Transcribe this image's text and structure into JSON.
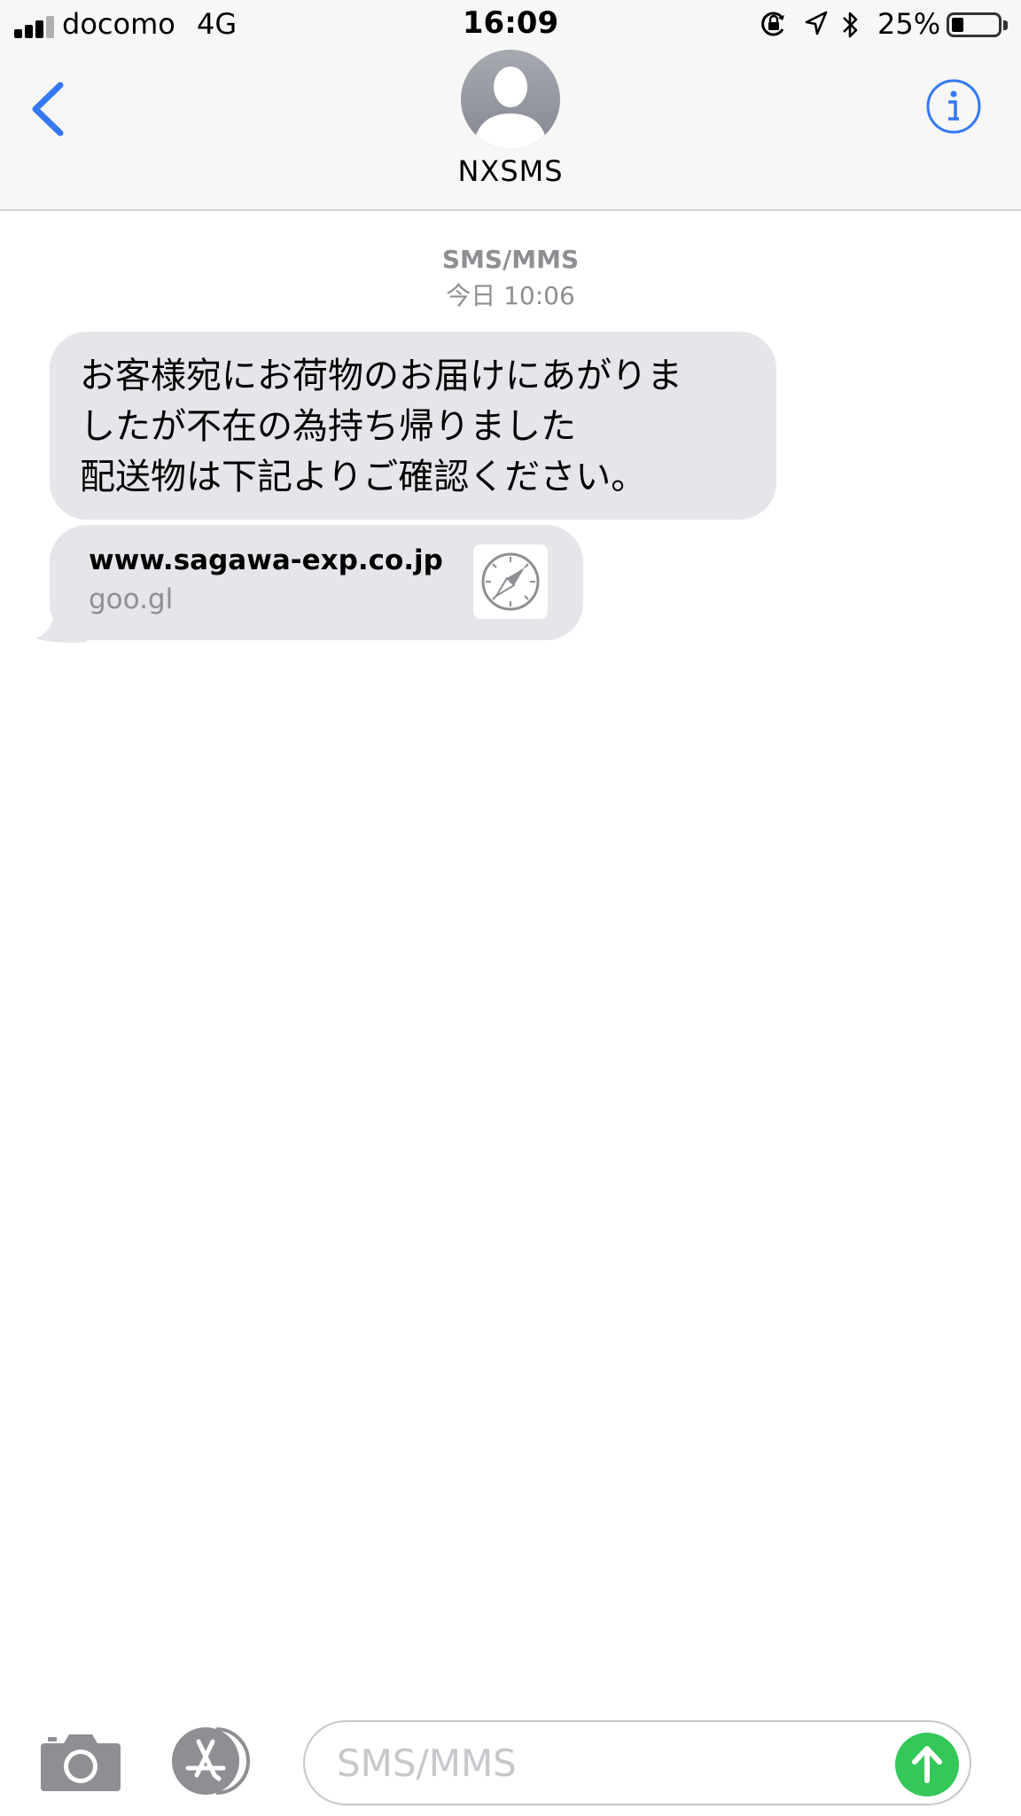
{
  "status_bar": {
    "carrier": "docomo",
    "network": "4G",
    "time": "16:09",
    "battery_percent": "25%",
    "battery_level": 0.25,
    "icons": [
      "signal-icon",
      "orientation-lock-icon",
      "location-icon",
      "bluetooth-icon",
      "battery-icon"
    ]
  },
  "header": {
    "contact_name": "NXSMS",
    "icons": [
      "back-chevron-icon",
      "contact-avatar-icon",
      "info-icon"
    ]
  },
  "conversation": {
    "service": "SMS/MMS",
    "timestamp": "今日 10:06",
    "message_text": "お客様宛にお荷物のお届けにあがりま\nしたが不在の為持ち帰りました\n配送物は下記よりご確認ください。",
    "link_preview": {
      "title": "www.sagawa-exp.co.jp",
      "domain": "goo.gl",
      "icon": "safari-compass-icon"
    }
  },
  "input_bar": {
    "placeholder": "SMS/MMS",
    "icons": [
      "camera-icon",
      "app-store-icon",
      "send-arrow-icon"
    ],
    "send_color": "#34c759"
  },
  "colors": {
    "accent": "#3478f6",
    "bubble_incoming": "#e5e5ea",
    "meta_text": "#8e8e93"
  }
}
